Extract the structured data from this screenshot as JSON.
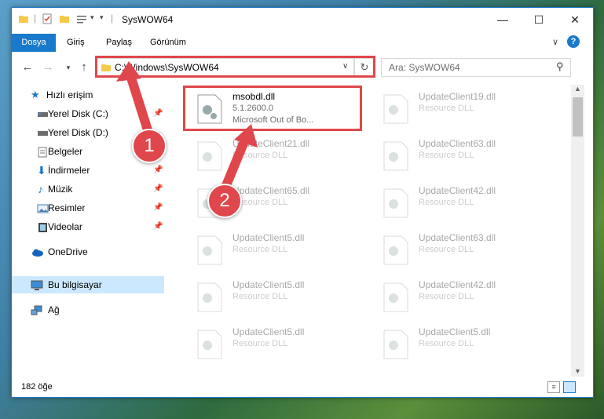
{
  "window": {
    "title": "SysWOW64"
  },
  "ribbon": {
    "tabs": [
      "Dosya",
      "Giriş",
      "Paylaş",
      "Görünüm"
    ]
  },
  "address": {
    "path": "C:\\Windows\\SysWOW64",
    "search_placeholder": "Ara: SysWOW64"
  },
  "sidebar": {
    "items": [
      {
        "label": "Hızlı erişim",
        "icon": "star-icon"
      },
      {
        "label": "Yerel Disk (C:)",
        "icon": "disk-icon"
      },
      {
        "label": "Yerel Disk (D:)",
        "icon": "disk-icon"
      },
      {
        "label": "Belgeler",
        "icon": "documents-icon"
      },
      {
        "label": "İndirmeler",
        "icon": "download-icon"
      },
      {
        "label": "Müzik",
        "icon": "music-icon"
      },
      {
        "label": "Resimler",
        "icon": "pictures-icon"
      },
      {
        "label": "Videolar",
        "icon": "videos-icon"
      },
      {
        "label": "OneDrive",
        "icon": "cloud-icon"
      },
      {
        "label": "Bu bilgisayar",
        "icon": "computer-icon"
      },
      {
        "label": "Ağ",
        "icon": "network-icon"
      }
    ]
  },
  "files": [
    {
      "name": "msobdl.dll",
      "line1": "5.1.2600.0",
      "line2": "Microsoft Out of Bo..."
    },
    {
      "name": "UpdateClient19.dll",
      "line1": "Resource DLL"
    },
    {
      "name": "UpdateClient21.dll",
      "line1": "Resource DLL"
    },
    {
      "name": "UpdateClient63.dll",
      "line1": "Resource DLL"
    },
    {
      "name": "UpdateClient65.dll",
      "line1": "Resource DLL"
    },
    {
      "name": "UpdateClient42.dll",
      "line1": "Resource DLL"
    },
    {
      "name": "UpdateClient5.dll",
      "line1": "Resource DLL"
    },
    {
      "name": "UpdateClient63.dll",
      "line1": "Resource DLL"
    },
    {
      "name": "UpdateClient5.dll",
      "line1": "Resource DLL"
    },
    {
      "name": "UpdateClient42.dll",
      "line1": "Resource DLL"
    },
    {
      "name": "UpdateClient5.dll",
      "line1": "Resource DLL"
    },
    {
      "name": "UpdateClient5.dll",
      "line1": "Resource DLL"
    }
  ],
  "status": {
    "count": "182 öğe"
  },
  "annotations": {
    "badge1": "1",
    "badge2": "2"
  },
  "colors": {
    "accent": "#1979ca",
    "highlight": "#e0474c"
  }
}
